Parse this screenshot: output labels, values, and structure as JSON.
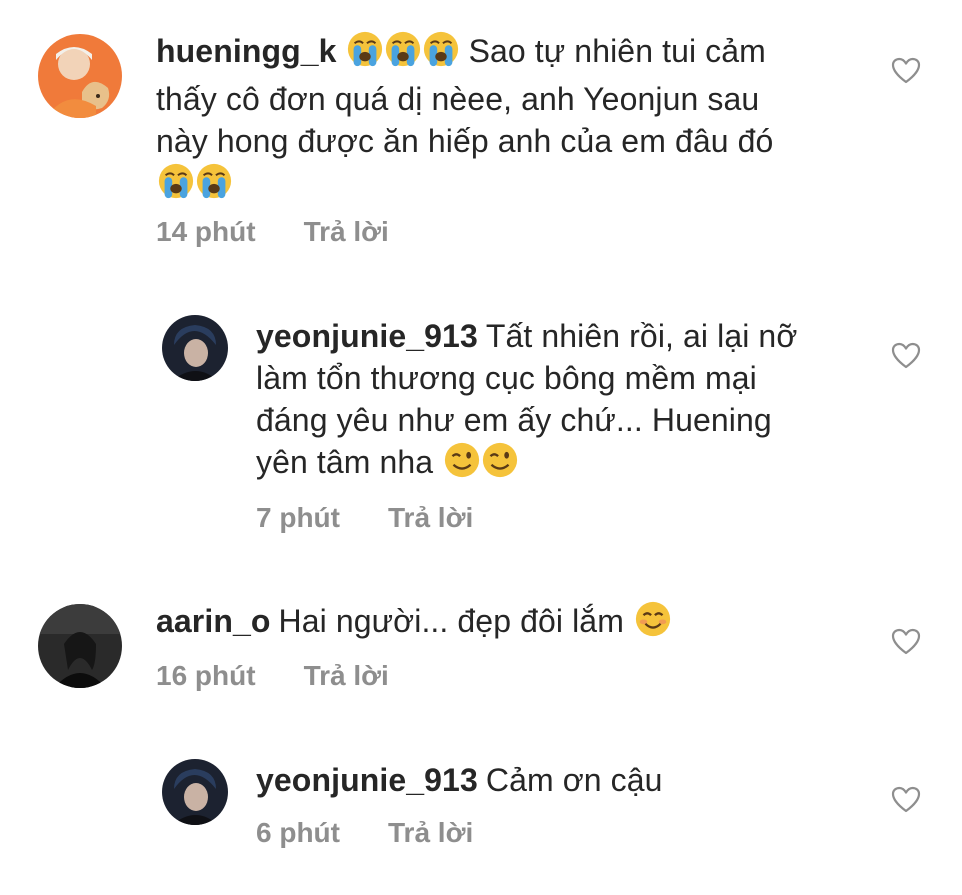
{
  "comments": [
    {
      "username": "hueningg_k",
      "text_part1": "Sao tự nhiên tui cảm thấy cô đơn quá dị nèee, anh Yeonjun sau này hong được ăn hiếp anh của em đâu đó",
      "line1": "Sao tự nhiên tui cảm",
      "line2": "thấy cô đơn quá dị nèee, anh Yeonjun sau",
      "line3": "này hong được ăn hiếp anh của em đâu đó",
      "time": "14 phút",
      "reply": "Trả lời",
      "emoji": "loudly-crying-face"
    },
    {
      "username": "yeonjunie_913",
      "line1": "Tất nhiên rồi, ai lại nỡ",
      "line2": "làm tổn thương cục bông mềm mại",
      "line3": "đáng yêu như em ấy chứ... Huening",
      "line4": "yên tâm nha",
      "time": "7 phút",
      "reply": "Trả lời",
      "emoji": "winking-face"
    },
    {
      "username": "aarin_o",
      "line1": "Hai người... đẹp đôi lắm",
      "time": "16 phút",
      "reply": "Trả lời",
      "emoji": "smiling-face"
    },
    {
      "username": "yeonjunie_913",
      "line1": "Cảm ơn cậu",
      "time": "6 phút",
      "reply": "Trả lời"
    }
  ],
  "colors": {
    "text": "#262626",
    "meta": "#8e8e8e",
    "heart": "#8e8e8e"
  }
}
